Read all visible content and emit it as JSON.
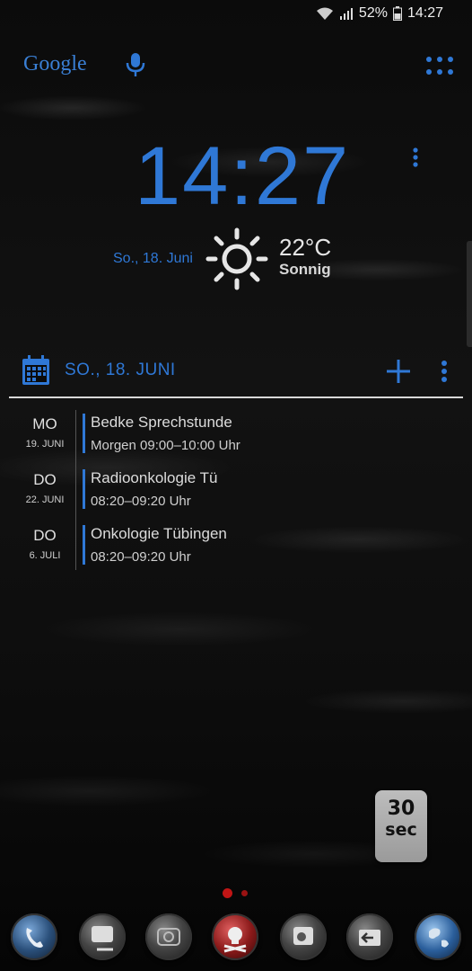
{
  "status": {
    "battery": "52%",
    "time": "14:27"
  },
  "search": {
    "brand": "Google"
  },
  "clock": {
    "time": "14:27",
    "date": "So., 18. Juni"
  },
  "weather": {
    "temp": "22°C",
    "condition": "Sonnig",
    "icon": "sun-icon"
  },
  "calendar": {
    "header_date": "SO., 18. JUNI",
    "events": [
      {
        "day": "MO",
        "date": "19. JUNI",
        "title": "Bedke Sprechstunde",
        "time": "Morgen 09:00–10:00 Uhr"
      },
      {
        "day": "DO",
        "date": "22. JUNI",
        "title": "Radioonkologie Tü",
        "time": "08:20–09:20 Uhr"
      },
      {
        "day": "DO",
        "date": "6. JULI",
        "title": "Onkologie Tübingen",
        "time": "08:20–09:20 Uhr"
      }
    ]
  },
  "timer_widget": {
    "number": "30",
    "unit": "sec"
  },
  "dock": [
    "phone-app",
    "messages-app",
    "camera-app",
    "pirate-app",
    "notes-app",
    "browser-app",
    "back-app",
    "globe-app"
  ],
  "colors": {
    "accent": "#2f78d6",
    "dot": "#c01515"
  }
}
